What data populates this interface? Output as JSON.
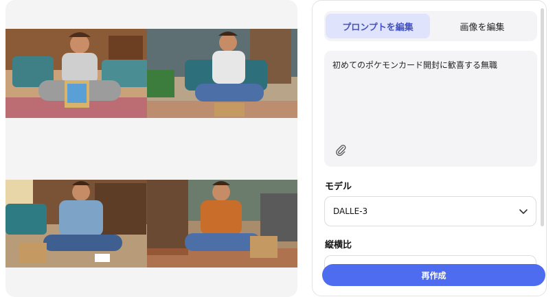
{
  "tabs": {
    "edit_prompt": "プロンプトを編集",
    "edit_image": "画像を編集"
  },
  "prompt": {
    "text": "初めてのポケモンカード開封に歓喜する無職"
  },
  "model": {
    "label": "モデル",
    "value": "DALLE-3"
  },
  "aspect_ratio": {
    "label": "縦横比"
  },
  "actions": {
    "regenerate": "再作成"
  },
  "icons": {
    "attach": "paperclip-icon",
    "dropdown": "chevron-down-icon"
  },
  "colors": {
    "accent": "#4e6cf0",
    "active_tab_bg": "#dfe3fb",
    "active_tab_text": "#4452c4"
  }
}
